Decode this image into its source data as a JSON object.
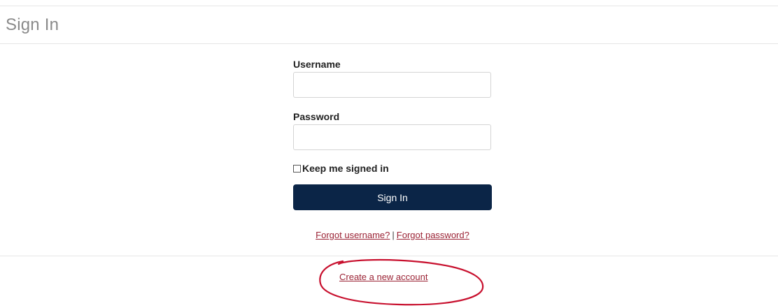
{
  "page": {
    "title": "Sign In"
  },
  "form": {
    "username_label": "Username",
    "username_value": "",
    "password_label": "Password",
    "password_value": "",
    "keep_signed_in_label": "Keep me signed in",
    "keep_signed_in_checked": false,
    "signin_button_label": "Sign In"
  },
  "links": {
    "forgot_username": "Forgot username?",
    "separator": "|",
    "forgot_password": "Forgot password?",
    "create_account": "Create a new account"
  },
  "colors": {
    "button_background": "#0b2547",
    "link": "#9b2335",
    "annotation": "#c8102e"
  }
}
